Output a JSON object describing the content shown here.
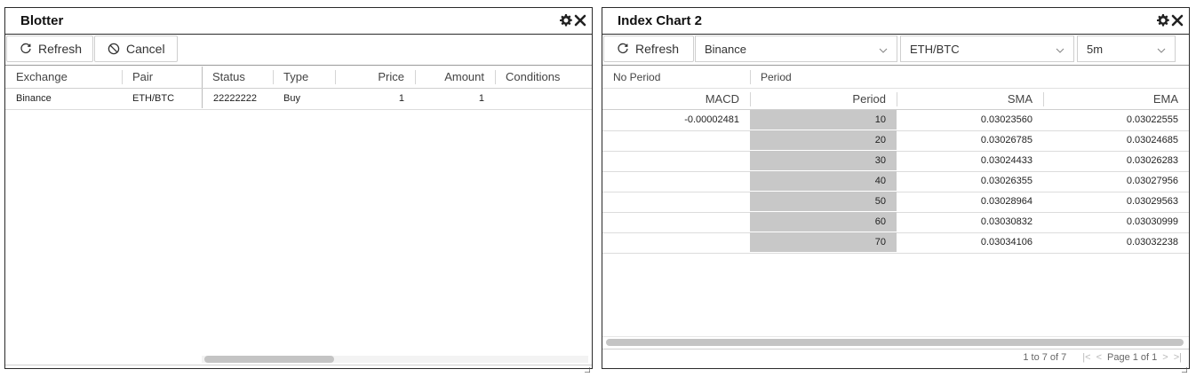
{
  "blotter": {
    "title": "Blotter",
    "toolbar": {
      "refresh_label": "Refresh",
      "cancel_label": "Cancel"
    },
    "columns": [
      "Exchange",
      "Pair",
      "Status",
      "Type",
      "Price",
      "Amount",
      "Conditions"
    ],
    "rows": [
      {
        "exchange": "Binance",
        "pair": "ETH/BTC",
        "status": "22222222",
        "type": "Buy",
        "price": "1",
        "amount": "1",
        "conditions": ""
      }
    ]
  },
  "chart": {
    "title": "Index Chart 2",
    "toolbar": {
      "refresh_label": "Refresh",
      "exchange_select": "Binance",
      "pair_select": "ETH/BTC",
      "interval_select": "5m"
    },
    "group_headers": [
      "No Period",
      "Period"
    ],
    "columns": [
      "MACD",
      "Period",
      "SMA",
      "EMA"
    ],
    "rows": [
      {
        "macd": "-0.00002481",
        "period": "10",
        "sma": "0.03023560",
        "ema": "0.03022555"
      },
      {
        "macd": "",
        "period": "20",
        "sma": "0.03026785",
        "ema": "0.03024685"
      },
      {
        "macd": "",
        "period": "30",
        "sma": "0.03024433",
        "ema": "0.03026283"
      },
      {
        "macd": "",
        "period": "40",
        "sma": "0.03026355",
        "ema": "0.03027956"
      },
      {
        "macd": "",
        "period": "50",
        "sma": "0.03028964",
        "ema": "0.03029563"
      },
      {
        "macd": "",
        "period": "60",
        "sma": "0.03030832",
        "ema": "0.03030999"
      },
      {
        "macd": "",
        "period": "70",
        "sma": "0.03034106",
        "ema": "0.03032238"
      }
    ],
    "pager": {
      "summary": "1 to 7 of 7",
      "page_text": "Page 1 of 1"
    }
  },
  "colors": {
    "period_column_bg": "#c8c8c8",
    "border": "#2a2a2a",
    "row_border": "#dcdcdc"
  },
  "icons": [
    "gear-icon",
    "close-icon",
    "refresh-icon",
    "cancel-icon",
    "chevron-down-icon",
    "first-page-icon",
    "prev-page-icon",
    "next-page-icon",
    "last-page-icon"
  ]
}
